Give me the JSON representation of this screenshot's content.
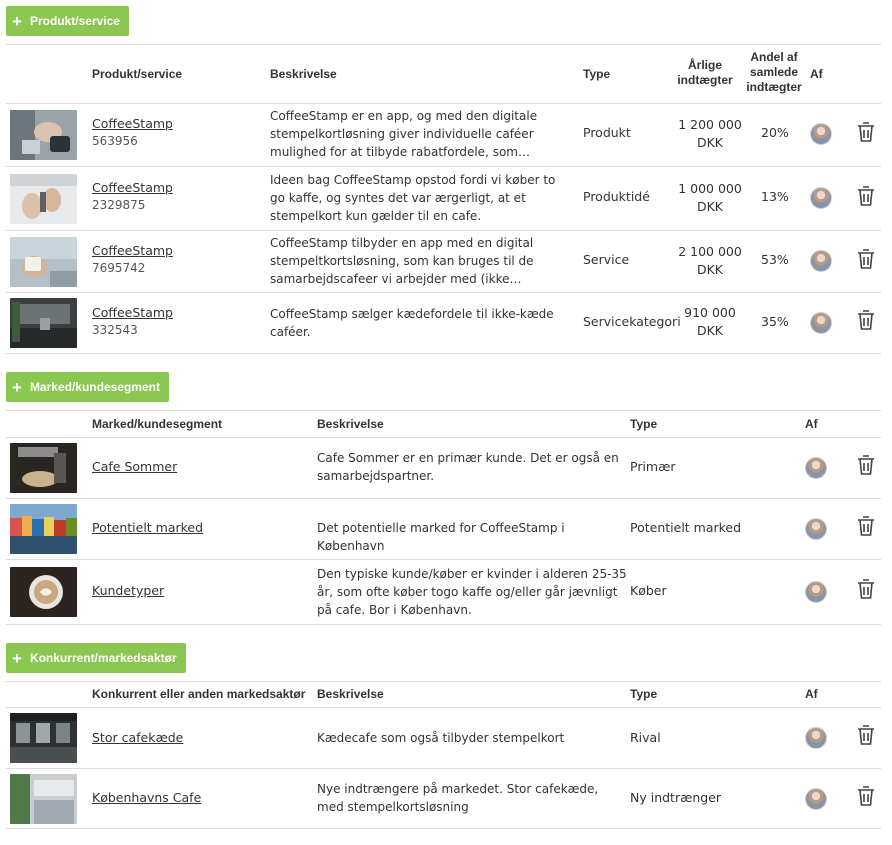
{
  "sections": {
    "products": {
      "add_label": "Produkt/service",
      "headers": {
        "name": "Produkt/service",
        "desc": "Beskrivelse",
        "type": "Type",
        "revenue": "Årlige indtægter",
        "share": "Andel af samlede indtægter",
        "by": "Af"
      },
      "rows": [
        {
          "name": "CoffeeStamp",
          "id": "563956",
          "desc": "CoffeeStamp er en app, og med den digitale stempelkortløsning giver individuelle caféer mulighed for at tilbyde rabatfordele, som…",
          "type": "Produkt",
          "revenue_amount": "1 200 000",
          "revenue_currency": "DKK",
          "share": "20%"
        },
        {
          "name": "CoffeeStamp",
          "id": "2329875",
          "desc": "Ideen bag CoffeeStamp opstod fordi vi køber to go kaffe, og syntes det var ærgerligt, at et stempelkort kun gælder til en cafe.",
          "type": "Produktidé",
          "revenue_amount": "1 000 000",
          "revenue_currency": "DKK",
          "share": "13%"
        },
        {
          "name": "CoffeeStamp",
          "id": "7695742",
          "desc": "CoffeeStamp tilbyder en app med en digital stempeltkortsløsning, som kan bruges til de samarbejdscafeer vi arbejder med (ikke…",
          "type": "Service",
          "revenue_amount": "2 100 000",
          "revenue_currency": "DKK",
          "share": "53%"
        },
        {
          "name": "CoffeeStamp",
          "id": "332543",
          "desc": "CoffeeStamp sælger kædefordele til ikke-kæde caféer.",
          "type": "Servicekategori",
          "revenue_amount": "910 000",
          "revenue_currency": "DKK",
          "share": "35%"
        }
      ]
    },
    "markets": {
      "add_label": "Marked/kundesegment",
      "headers": {
        "name": "Marked/kundesegment",
        "desc": "Beskrivelse",
        "type": "Type",
        "by": "Af"
      },
      "rows": [
        {
          "name": "Cafe Sommer",
          "desc": "Cafe Sommer er en primær kunde. Det er også en samarbejdspartner.",
          "type": "Primær"
        },
        {
          "name": "Potentielt marked",
          "desc": "Det potentielle marked for CoffeeStamp i København",
          "type": "Potentielt marked"
        },
        {
          "name": "Kundetyper",
          "desc": "Den typiske kunde/køber er kvinder i alderen 25-35 år, som ofte køber togo kaffe og/eller går jævnligt på cafe. Bor i København.",
          "type": "Køber"
        }
      ]
    },
    "competitors": {
      "add_label": "Konkurrent/markedsaktør",
      "headers": {
        "name": "Konkurrent eller anden markedsaktør",
        "desc": "Beskrivelse",
        "type": "Type",
        "by": "Af"
      },
      "rows": [
        {
          "name": "Stor cafekæde",
          "desc": "Kædecafe som også tilbyder stempelkort",
          "type": "Rival"
        },
        {
          "name": "Københavns Cafe",
          "desc": "Nye indtrængere på markedet. Stor cafekæde, med stempelkortsløsning",
          "type": "Ny indtrænger"
        }
      ]
    }
  },
  "colors": {
    "accent": "#8bc750",
    "border": "#dddddd",
    "text": "#333333"
  },
  "icons": {
    "add": "plus-icon",
    "delete": "trash-icon",
    "author": "avatar"
  }
}
